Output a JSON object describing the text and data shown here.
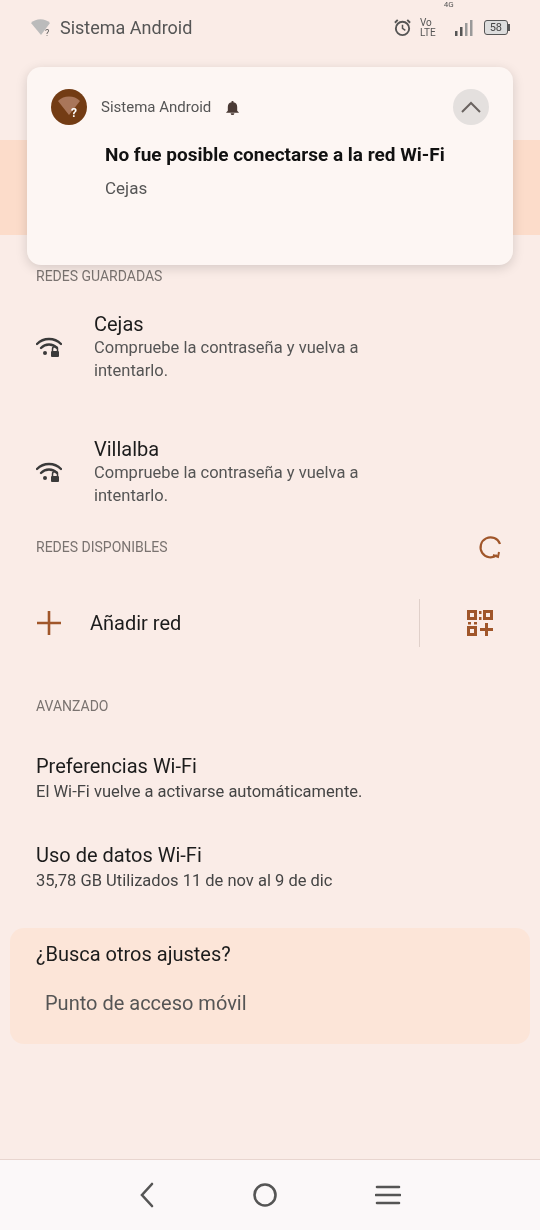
{
  "status_bar": {
    "icon_badge": "?",
    "app": "Sistema Android",
    "network_top": "Vo",
    "network_bottom": "LTE",
    "network_type": "4G",
    "battery": "58"
  },
  "notification": {
    "icon_badge": "?",
    "app": "Sistema Android",
    "title": "No fue posible conectarse a la red Wi-Fi",
    "text": "Cejas",
    "expanded": true
  },
  "saved_networks": {
    "header": "REDES GUARDADAS",
    "items": [
      {
        "name": "Cejas",
        "status": "Compruebe la contraseña y vuelva a intentarlo."
      },
      {
        "name": "Villalba",
        "status": "Compruebe la contraseña y vuelva a intentarlo."
      }
    ]
  },
  "available_networks": {
    "header": "REDES DISPONIBLES",
    "add_label": "Añadir red"
  },
  "advanced": {
    "header": "AVANZADO",
    "items": [
      {
        "title": "Preferencias Wi-Fi",
        "subtitle": "El Wi-Fi vuelve a activarse automáticamente."
      },
      {
        "title": "Uso de datos Wi-Fi",
        "subtitle": "35,78 GB Utilizados 11 de nov al 9 de dic"
      }
    ]
  },
  "other_settings": {
    "title": "¿Busca otros ajustes?",
    "items": [
      "Punto de acceso móvil"
    ]
  }
}
